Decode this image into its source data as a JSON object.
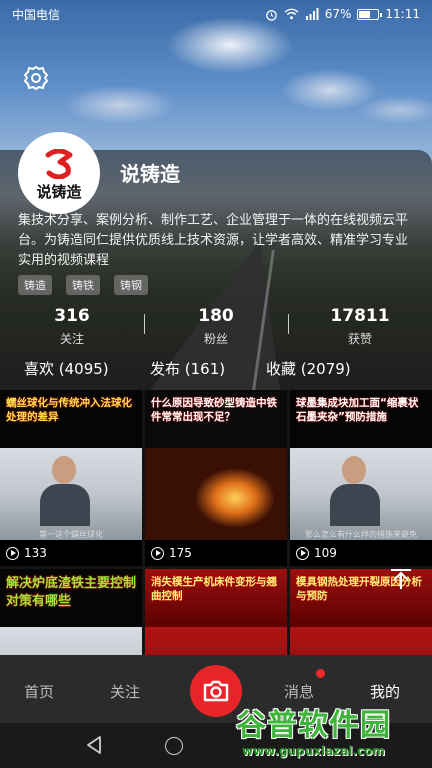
{
  "status_bar": {
    "carrier": "中国电信",
    "battery": "67%",
    "battery_level": 0.67,
    "time": "11:11"
  },
  "profile": {
    "avatar_text": "说铸造",
    "name": "说铸造",
    "bio": "集技术分享、案例分析、制作工艺、企业管理于一体的在线视频云平台。为铸造同仁提供优质线上技术资源，让学者高效、精准学习专业实用的视频课程",
    "tags": [
      "铸造",
      "铸铁",
      "铸钢"
    ]
  },
  "stats": [
    {
      "value": "316",
      "label": "关注"
    },
    {
      "value": "180",
      "label": "粉丝"
    },
    {
      "value": "17811",
      "label": "获赞"
    }
  ],
  "tabs": [
    {
      "label": "喜欢 (4095)"
    },
    {
      "label": "发布 (161)"
    },
    {
      "label": "收藏 (2079)"
    }
  ],
  "videos": [
    {
      "title": "蠕丝球化与传统冲入法球化处理的差异",
      "caption": "第一这个蠕丝球化",
      "views": "133"
    },
    {
      "title": "什么原因导致砂型铸造中铁件常常出现不足？",
      "caption": "",
      "views": "175"
    },
    {
      "title": "球墨集成块加工面“缩裹状石墨夹杂”预防措施",
      "caption": "那么怎么有什么样的措施来避免",
      "views": "109"
    },
    {
      "title": "解决炉底渣铁主要控制对策有哪些",
      "caption": "",
      "views": ""
    },
    {
      "title": "消失模生产机床件变形与翘曲控制",
      "caption": "",
      "views": ""
    },
    {
      "title": "模具钢热处理开裂原因分析与预防",
      "caption": "",
      "views": ""
    }
  ],
  "bottom_nav": {
    "home": "首页",
    "follow": "关注",
    "messages": "消息",
    "me": "我的"
  },
  "watermark": {
    "title": "谷普软件园",
    "url": "www.gupuxlazal.com"
  },
  "colors": {
    "accent": "#e8262a",
    "video_title_yellow": "#f6e04a"
  }
}
